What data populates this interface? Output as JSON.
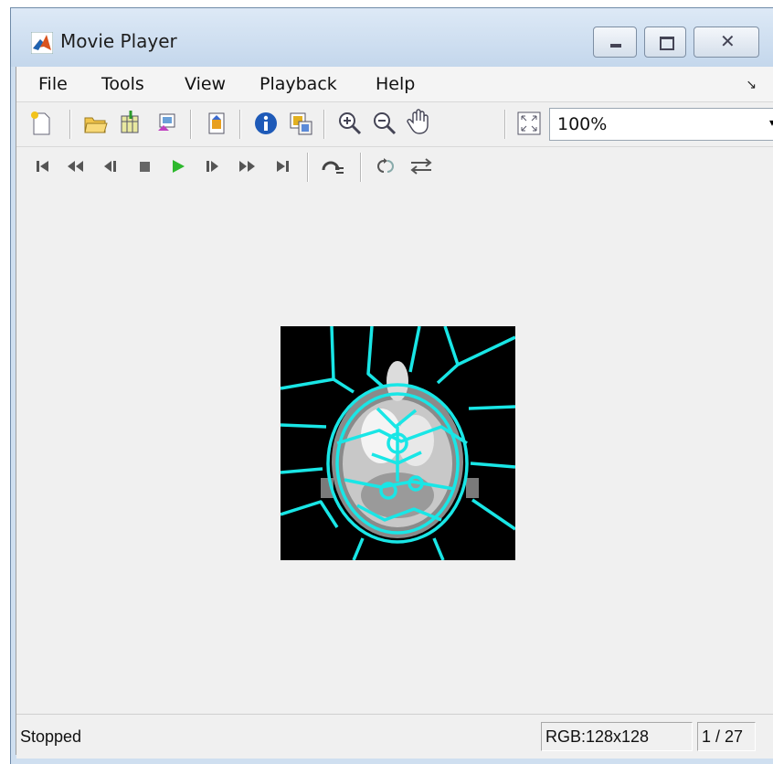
{
  "window": {
    "title": "Movie Player",
    "app_icon": "matlab-icon"
  },
  "window_controls": {
    "minimize": "minimize-icon",
    "maximize": "maximize-icon",
    "close": "close-icon"
  },
  "menu": {
    "items": [
      "File",
      "Tools",
      "View",
      "Playback",
      "Help"
    ],
    "overflow_arrow": "↘"
  },
  "toolbar": {
    "icons": [
      "new-window-icon",
      "open-file-icon",
      "import-workspace-icon",
      "export-icon",
      "display-configuration-icon",
      "info-icon",
      "colormap-icon",
      "zoom-in-icon",
      "zoom-out-icon",
      "pan-icon",
      "fit-to-window-icon"
    ],
    "zoom_value": "100%"
  },
  "playback": {
    "controls": [
      "go-to-first-icon",
      "rewind-icon",
      "step-back-icon",
      "stop-icon",
      "play-icon",
      "step-forward-icon",
      "fast-forward-icon",
      "go-to-last-icon",
      "jump-to-icon",
      "repeat-icon",
      "forward-backward-icon"
    ],
    "play_color": "#2db82d",
    "overlay_color": "#19e6e6"
  },
  "status": {
    "text": "Stopped",
    "format": "RGB:128x128",
    "frame": "1 / 27"
  }
}
